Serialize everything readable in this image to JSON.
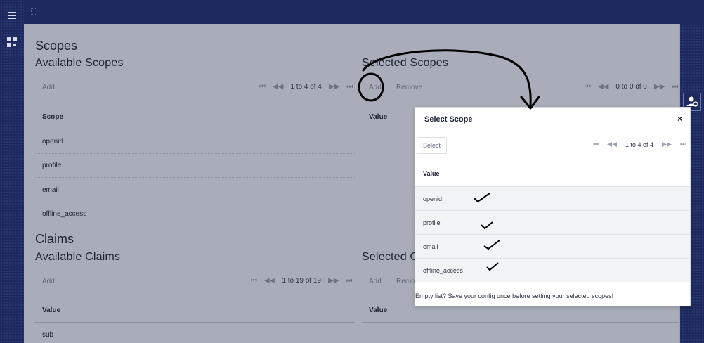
{
  "left_nav": {
    "menu_icon": "hamburger-icon",
    "app_icon": "grid-logo-icon"
  },
  "scopes": {
    "title": "Scopes",
    "available": {
      "title": "Available Scopes",
      "add_label": "Add",
      "pager_text": "1 to 4 of 4",
      "column": "Scope",
      "rows": [
        "openid",
        "profile",
        "email",
        "offline_access"
      ]
    },
    "selected": {
      "title": "Selected Scopes",
      "add_label": "Add",
      "remove_label": "Remove",
      "pager_text": "0 to 0 of 0",
      "column": "Value"
    }
  },
  "claims": {
    "title": "Claims",
    "available": {
      "title": "Available Claims",
      "add_label": "Add",
      "pager_text": "1 to 19 of 19",
      "column": "Value",
      "rows": [
        "sub"
      ]
    },
    "selected": {
      "title": "Selected C",
      "add_label": "Add",
      "remove_label": "Remo",
      "column": "Value"
    }
  },
  "modal": {
    "title": "Select Scope",
    "close_label": "×",
    "select_label": "Select",
    "pager_text": "1 to 4 of 4",
    "column": "Value",
    "rows": [
      "openid",
      "profile",
      "email",
      "offline_access"
    ],
    "footer": "Empty list? Save your config once before setting your selected scopes!"
  },
  "colors": {
    "nav_bg": "#1e2a5e",
    "overlay_page": "#a9adb9",
    "modal_bg": "#ffffff",
    "row_bg": "#f2f3f5"
  }
}
